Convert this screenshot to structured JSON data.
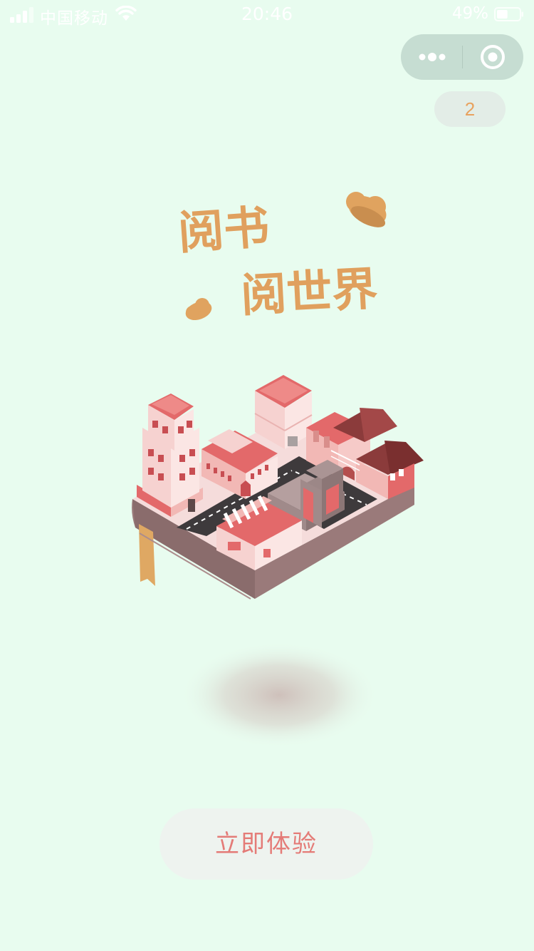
{
  "status_bar": {
    "carrier": "中国移动",
    "time": "20:46",
    "battery_percent": "49%",
    "battery_level": 0.49,
    "icons": [
      "signal-icon",
      "wifi-icon",
      "battery-icon"
    ]
  },
  "capsule": {
    "more_icon": "more-dots-icon",
    "close_icon": "target-circle-icon"
  },
  "countdown": {
    "value": "2"
  },
  "hero": {
    "line1": "阅书",
    "line2": "阅世界"
  },
  "cta": {
    "label": "立即体验"
  },
  "colors": {
    "background": "#e8fcef",
    "title_orange": "#e0a05e",
    "accent_red": "#e47b77",
    "building_pink": "#f2b8b5",
    "building_red": "#e3696a",
    "base_brown": "#9a7a7a"
  }
}
